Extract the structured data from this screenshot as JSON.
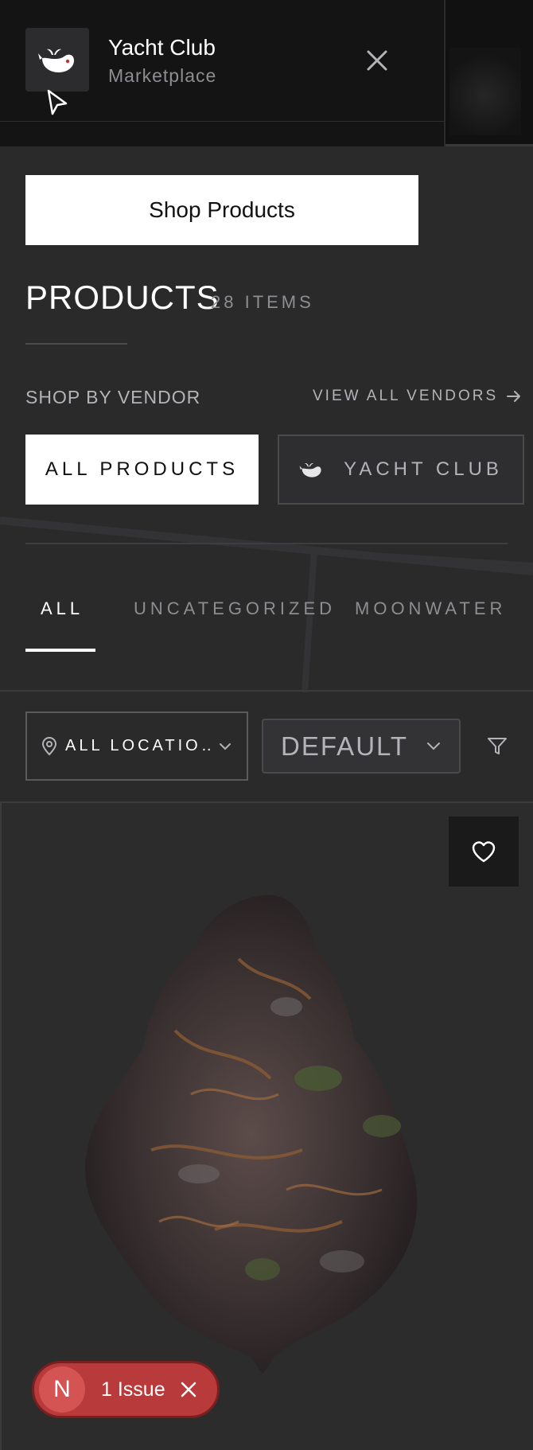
{
  "header": {
    "brand_title": "Yacht Club",
    "brand_subtitle": "Marketplace",
    "logo_icon": "whale-icon",
    "close_icon": "close-icon"
  },
  "shop_button": "Shop Products",
  "products": {
    "title": "PRODUCTS",
    "count_label": "28 ITEMS"
  },
  "vendors": {
    "section_label": "SHOP BY VENDOR",
    "view_all_label": "VIEW ALL VENDORS",
    "items": [
      {
        "label": "ALL PRODUCTS",
        "selected": true
      },
      {
        "label": "YACHT CLUB",
        "selected": false,
        "icon": "whale-icon"
      }
    ]
  },
  "category_tabs": [
    {
      "label": "ALL",
      "active": true
    },
    {
      "label": "UNCATEGORIZED",
      "active": false
    },
    {
      "label": "MOONWATER",
      "active": false
    }
  ],
  "filters": {
    "location_value": "ALL LOCATIO…",
    "sort_value": "DEFAULT",
    "filter_icon": "funnel-icon"
  },
  "product_card": {
    "favorite_icon": "heart-icon",
    "image": "cannabis-flower-image"
  },
  "dev_overlay": {
    "badge_letter": "N",
    "issue_label": "1 Issue"
  },
  "colors": {
    "background": "#2a2a2b",
    "header_bg": "#141415",
    "primary_button_bg": "#ffffff",
    "issue_badge": "#b83a3a"
  }
}
